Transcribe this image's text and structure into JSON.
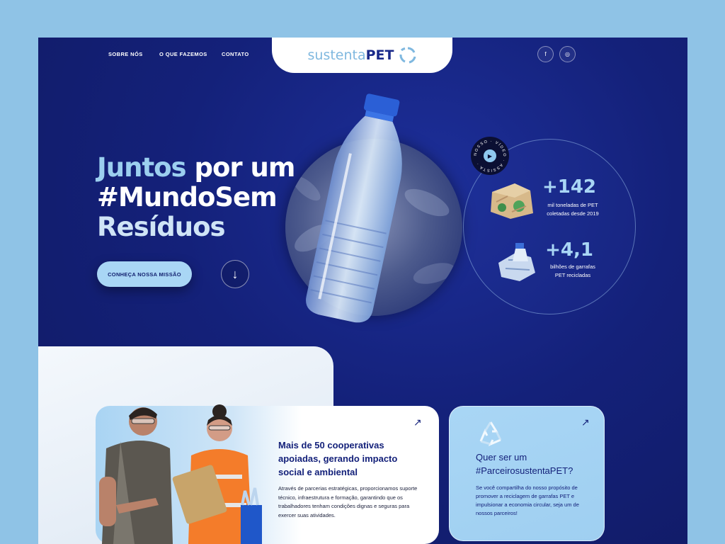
{
  "nav": {
    "links": [
      "SOBRE NÓS",
      "O QUE FAZEMOS",
      "CONTATO"
    ],
    "logo_light": "sustenta",
    "logo_bold": "PET",
    "social": [
      "f",
      "◎"
    ]
  },
  "hero": {
    "title_word1": "Juntos",
    "title_rest1": " por um",
    "title_line2": "#MundoSem",
    "title_line3": "Resíduos",
    "cta_label": "CONHEÇA NOSSA MISSÃO",
    "scroll_icon": "↓"
  },
  "video_badge": {
    "ring_text": "NOSSO · VÍDEO · ASSISTA ·"
  },
  "stats": [
    {
      "value": "+142",
      "desc_line1": "mil toneladas de PET",
      "desc_line2": "coletadas desde 2019"
    },
    {
      "value": "+4,1",
      "desc_line1": "bilhões de garrafas",
      "desc_line2": "PET recicladas"
    }
  ],
  "cooperatives_card": {
    "title": "Mais de 50 cooperativas apoiadas, gerando impacto social e ambiental",
    "body": "Através de parcerias estratégicas, proporcionamos suporte técnico, infraestrutura e formação, garantindo que os trabalhadores tenham condições dignas e seguras para exercer suas atividades.",
    "arrow": "↗"
  },
  "partner_card": {
    "title_line1": "Quer ser um",
    "title_line2": "#ParceirosustentaPET?",
    "body": "Se você compartilha do nosso propósito de promover a reciclagem de garrafas PET e impulsionar a economia circular, seja um de nossos parceiros!",
    "arrow": "↗"
  },
  "colors": {
    "navy": "#14217a",
    "light_blue": "#a9d6f5",
    "background": "#8fc3e6"
  }
}
